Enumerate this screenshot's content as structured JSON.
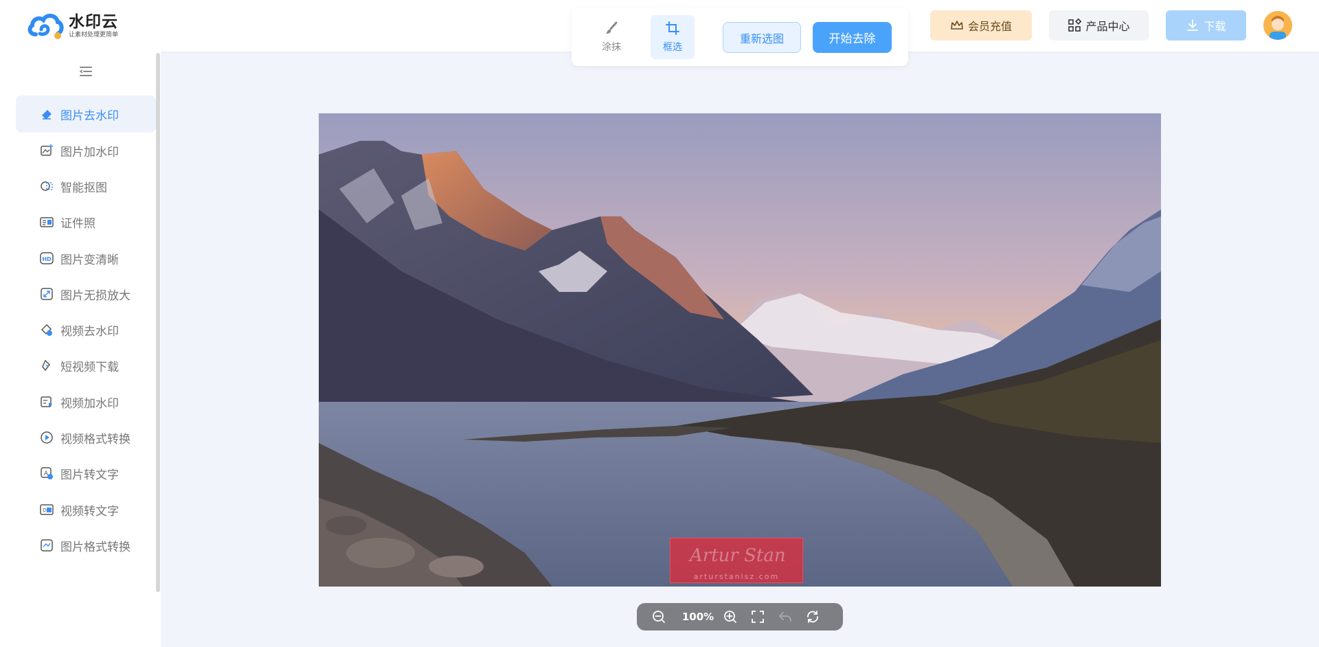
{
  "brand": {
    "name": "水印云",
    "tagline": "让素材处理更简单"
  },
  "header": {
    "vip_label": "会员充值",
    "product_label": "产品中心",
    "download_label": "下载"
  },
  "toolpanel": {
    "brush_label": "涂抹",
    "crop_label": "框选",
    "active_tool": "框选",
    "reselect_label": "重新选图",
    "start_label": "开始去除"
  },
  "sidebar": {
    "items": [
      {
        "label": "图片去水印",
        "icon": "eraser-icon",
        "active": true
      },
      {
        "label": "图片加水印",
        "icon": "image-add-icon"
      },
      {
        "label": "智能抠图",
        "icon": "cutout-icon"
      },
      {
        "label": "证件照",
        "icon": "id-card-icon"
      },
      {
        "label": "图片变清晰",
        "icon": "hd-icon"
      },
      {
        "label": "图片无损放大",
        "icon": "enlarge-icon"
      },
      {
        "label": "视频去水印",
        "icon": "video-eraser-icon"
      },
      {
        "label": "短视频下载",
        "icon": "link-icon"
      },
      {
        "label": "视频加水印",
        "icon": "video-add-icon"
      },
      {
        "label": "视频格式转换",
        "icon": "play-circle-icon"
      },
      {
        "label": "图片转文字",
        "icon": "image-text-icon"
      },
      {
        "label": "视频转文字",
        "icon": "video-text-icon"
      },
      {
        "label": "图片格式转换",
        "icon": "format-icon"
      }
    ]
  },
  "canvas": {
    "watermark_text": "arturstanisz.com",
    "watermark_signature": "Artur Stan"
  },
  "zoombar": {
    "zoom": "100%"
  },
  "colors": {
    "accent": "#3a8ef6",
    "primary_button": "#4aa3fb",
    "vip": "#fde8cc",
    "selection": "#e62837"
  }
}
